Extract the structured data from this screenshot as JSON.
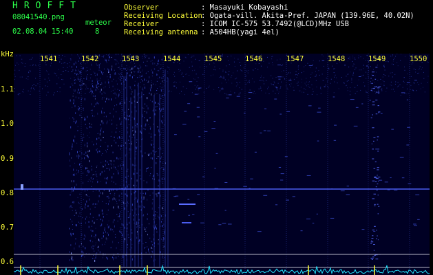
{
  "header": {
    "app_title": "HROFFT",
    "filename": "08041540.png",
    "datetime": "02.08.04 15:40",
    "meteor_label": "meteor",
    "meteor_count": "8"
  },
  "station": {
    "observer_label": "Observer",
    "observer_value": ": Masayuki Kobayashi",
    "location_label": "Receiving Location",
    "location_value": ": Ogata-vill. Akita-Pref. JAPAN (139.96E, 40.02N)",
    "receiver_label": "Receiver",
    "receiver_value": ": ICOM IC-575 53.7492(@LCD)MHz USB",
    "antenna_label": "Receiving antenna",
    "antenna_value": ": A504HB(yagi 4el)"
  },
  "axes": {
    "y_unit": "kHz",
    "y_ticks": [
      "1.1",
      "1.0",
      "0.9",
      "0.8",
      "0.7",
      "0.6"
    ],
    "x_ticks": [
      "1541",
      "1542",
      "1543",
      "1544",
      "1545",
      "1546",
      "1547",
      "1548",
      "1549",
      "1550"
    ]
  },
  "colors": {
    "background": "#000000",
    "plot_background": "#000024",
    "header_text": "#2cff4a",
    "label_text": "#ffff3a",
    "echo": "#6a7cff",
    "spectrum": "#22e6ff"
  }
}
